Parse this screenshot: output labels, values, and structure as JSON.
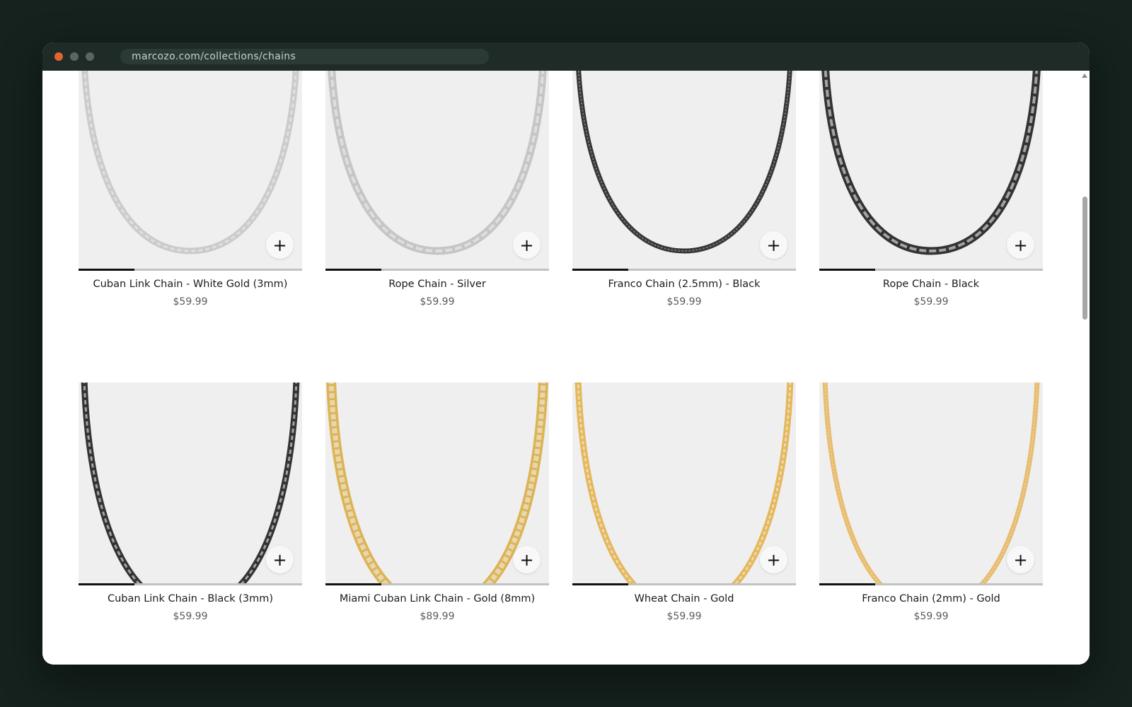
{
  "browser": {
    "url": "marcozo.com/collections/chains"
  },
  "products": [
    {
      "title": "Cuban Link Chain - White Gold (3mm)",
      "price": "$59.99",
      "add_label": "+",
      "chain_color": "#c4c4c4",
      "chain_style": "curb"
    },
    {
      "title": "Rope Chain - Silver",
      "price": "$59.99",
      "add_label": "+",
      "chain_color": "#bdbdbd",
      "chain_style": "rope"
    },
    {
      "title": "Franco Chain (2.5mm) - Black",
      "price": "$59.99",
      "add_label": "+",
      "chain_color": "#141414",
      "chain_style": "franco"
    },
    {
      "title": "Rope Chain - Black",
      "price": "$59.99",
      "add_label": "+",
      "chain_color": "#121212",
      "chain_style": "rope"
    },
    {
      "title": "Cuban Link Chain - Black (3mm)",
      "price": "$59.99",
      "add_label": "+",
      "chain_color": "#121212",
      "chain_style": "curb"
    },
    {
      "title": "Miami Cuban Link Chain - Gold (8mm)",
      "price": "$89.99",
      "add_label": "+",
      "chain_color": "#d9a93a",
      "chain_style": "miami"
    },
    {
      "title": "Wheat Chain - Gold",
      "price": "$59.99",
      "add_label": "+",
      "chain_color": "#e3ad3e",
      "chain_style": "wheat"
    },
    {
      "title": "Franco Chain (2mm) - Gold",
      "price": "$59.99",
      "add_label": "+",
      "chain_color": "#e6b355",
      "chain_style": "franco"
    }
  ],
  "partial_products": [
    {
      "chain_color": "#d8a638"
    },
    {
      "chain_color": "#bdbdbd"
    },
    {
      "chain_color": "#b8b8b8"
    },
    {
      "chain_color": "#9a9a9a"
    }
  ],
  "image_carousel": {
    "current_image": 1,
    "total_images": 4
  }
}
